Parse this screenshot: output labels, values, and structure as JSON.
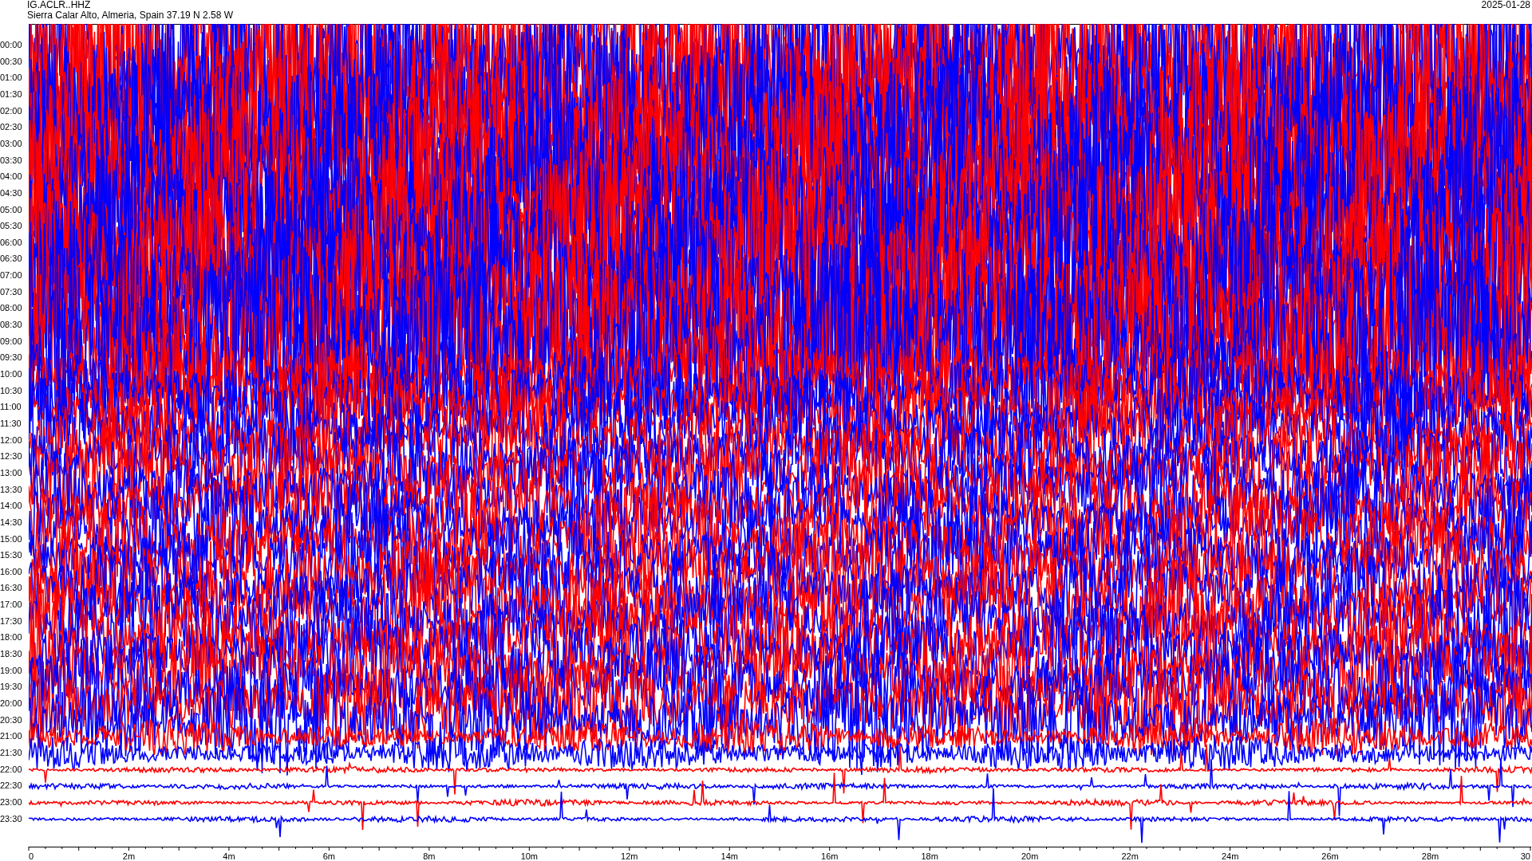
{
  "header": {
    "station_code": "IG.ACLR..HHZ",
    "location": "Sierra Calar Alto, Almeria, Spain  37.19 N 2.58 W",
    "date": "2025-01-28"
  },
  "rows": [
    {
      "label": "00:00"
    },
    {
      "label": "00:30"
    },
    {
      "label": "01:00"
    },
    {
      "label": "01:30"
    },
    {
      "label": "02:00"
    },
    {
      "label": "02:30"
    },
    {
      "label": "03:00"
    },
    {
      "label": "03:30"
    },
    {
      "label": "04:00"
    },
    {
      "label": "04:30"
    },
    {
      "label": "05:00"
    },
    {
      "label": "05:30"
    },
    {
      "label": "06:00"
    },
    {
      "label": "06:30"
    },
    {
      "label": "07:00"
    },
    {
      "label": "07:30"
    },
    {
      "label": "08:00"
    },
    {
      "label": "08:30"
    },
    {
      "label": "09:00"
    },
    {
      "label": "09:30"
    },
    {
      "label": "10:00"
    },
    {
      "label": "10:30"
    },
    {
      "label": "11:00"
    },
    {
      "label": "11:30"
    },
    {
      "label": "12:00"
    },
    {
      "label": "12:30"
    },
    {
      "label": "13:00"
    },
    {
      "label": "13:30"
    },
    {
      "label": "14:00"
    },
    {
      "label": "14:30"
    },
    {
      "label": "15:00"
    },
    {
      "label": "15:30"
    },
    {
      "label": "16:00"
    },
    {
      "label": "16:30"
    },
    {
      "label": "17:00"
    },
    {
      "label": "17:30"
    },
    {
      "label": "18:00"
    },
    {
      "label": "18:30"
    },
    {
      "label": "19:00"
    },
    {
      "label": "19:30"
    },
    {
      "label": "20:00"
    },
    {
      "label": "20:30"
    },
    {
      "label": "21:00"
    },
    {
      "label": "21:30"
    },
    {
      "label": "22:00"
    },
    {
      "label": "22:30"
    },
    {
      "label": "23:00"
    },
    {
      "label": "23:30"
    }
  ],
  "x_axis": {
    "ticks": [
      "0",
      "2m",
      "4m",
      "6m",
      "8m",
      "10m",
      "12m",
      "14m",
      "16m",
      "18m",
      "20m",
      "22m",
      "24m",
      "26m",
      "28m",
      "30"
    ]
  }
}
